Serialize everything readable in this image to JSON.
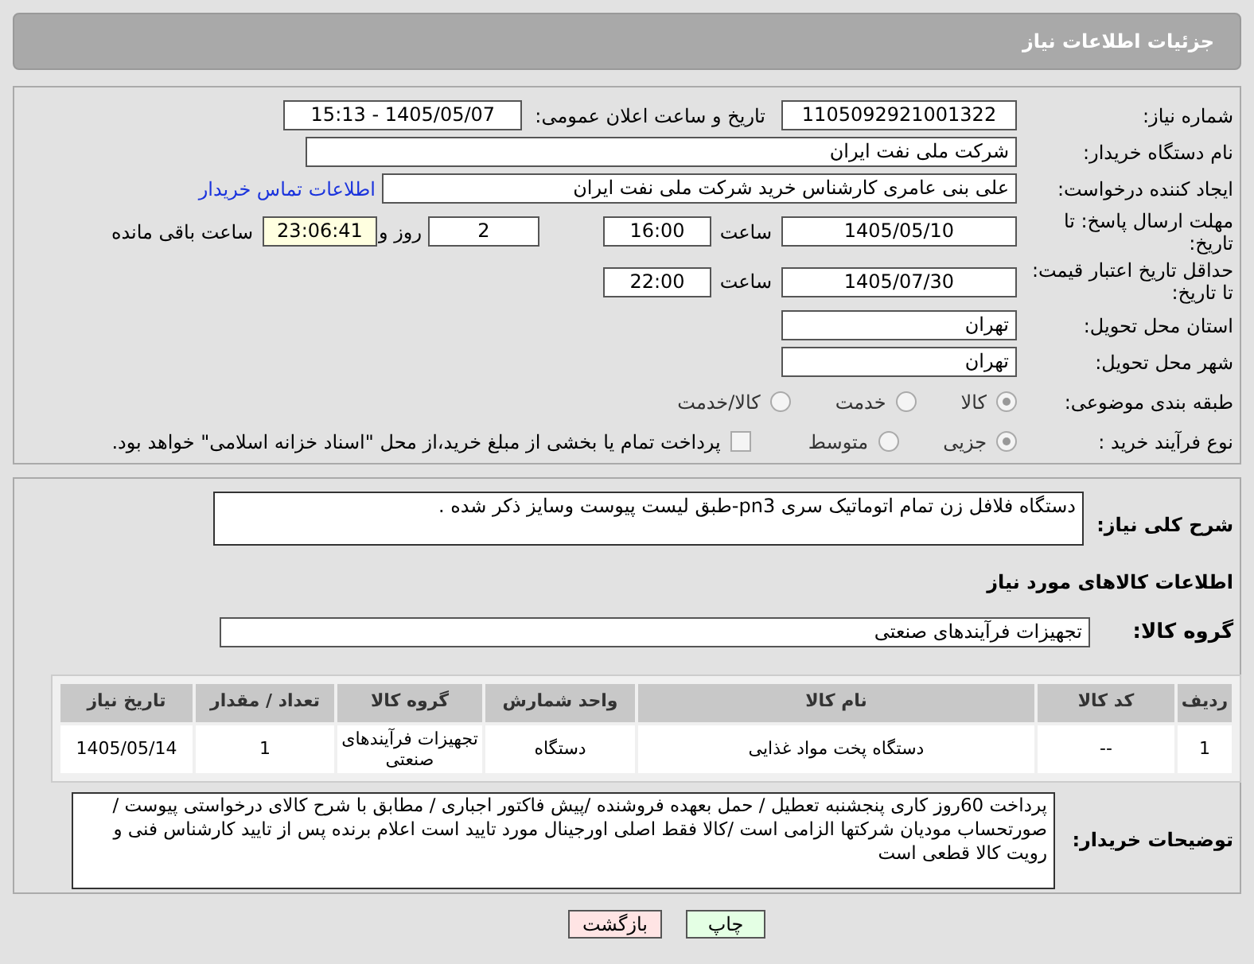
{
  "header": {
    "title": "جزئیات اطلاعات نیاز"
  },
  "need_number": {
    "label": "شماره نیاز:",
    "value": "1105092921001322"
  },
  "announce": {
    "label": "تاریخ و ساعت اعلان عمومی:",
    "value": "1405/05/07 - 15:13"
  },
  "buyer_org": {
    "label": "نام دستگاه خریدار:",
    "value": "شرکت ملی نفت ایران"
  },
  "requester": {
    "label": "ایجاد کننده درخواست:",
    "value": "علی بنی عامری کارشناس خرید  شرکت ملی نفت ایران",
    "link": "اطلاعات تماس خریدار"
  },
  "deadline": {
    "label": "مهلت ارسال پاسخ: تا تاریخ:",
    "date": "1405/05/10",
    "time_label": "ساعت",
    "time": "16:00",
    "days": "2",
    "days_label": "روز و",
    "remaining": "23:06:41",
    "remaining_label": "ساعت باقی مانده"
  },
  "validity": {
    "label": "حداقل تاریخ اعتبار قیمت: تا تاریخ:",
    "date": "1405/07/30",
    "time_label": "ساعت",
    "time": "22:00"
  },
  "province": {
    "label": "استان محل تحویل:",
    "value": "تهران"
  },
  "city": {
    "label": "شهر محل تحویل:",
    "value": "تهران"
  },
  "category": {
    "label": "طبقه بندی موضوعی:",
    "options": [
      {
        "label": "کالا",
        "selected": true
      },
      {
        "label": "خدمت",
        "selected": false
      },
      {
        "label": "کالا/خدمت",
        "selected": false
      }
    ]
  },
  "purchase_type": {
    "label": "نوع فرآیند خرید :",
    "options": [
      {
        "label": "جزیی",
        "selected": true
      },
      {
        "label": "متوسط",
        "selected": false
      }
    ],
    "treasury": {
      "label": "پرداخت تمام یا بخشی از مبلغ خرید،از محل \"اسناد خزانه اسلامی\" خواهد بود.",
      "checked": false
    }
  },
  "description": {
    "label": "شرح کلی نیاز:",
    "value": "دستگاه فلافل زن تمام اتوماتیک  سری pn3-طبق لیست پیوست وسایز ذکر شده ."
  },
  "goods_section": {
    "title": "اطلاعات کالاهای مورد نیاز"
  },
  "goods_group": {
    "label": "گروه کالا:",
    "value": "تجهیزات فرآیندهای صنعتی"
  },
  "table": {
    "columns": [
      "ردیف",
      "کد کالا",
      "نام کالا",
      "واحد شمارش",
      "گروه کالا",
      "تعداد / مقدار",
      "تاریخ نیاز"
    ],
    "rows": [
      [
        "1",
        "--",
        "دستگاه پخت مواد غذایی",
        "دستگاه",
        "تجهیزات فرآیندهای صنعتی",
        "1",
        "1405/05/14"
      ]
    ]
  },
  "buyer_notes": {
    "label": "توضیحات خریدار:",
    "value": "پرداخت 60روز کاری پنجشنبه تعطیل / حمل بعهده فروشنده /پیش فاکتور اجباری / مطابق با شرح کالای  درخواستی پیوست / صورتحساب مودیان شرکتها الزامی است /کالا فقط اصلی اورجینال مورد تایید است اعلام برنده پس از تایید کارشناس فنی و رویت کالا  قطعی است"
  },
  "buttons": [
    {
      "label": "چاپ",
      "kind": "print"
    },
    {
      "label": "بازگشت",
      "kind": "back"
    }
  ]
}
